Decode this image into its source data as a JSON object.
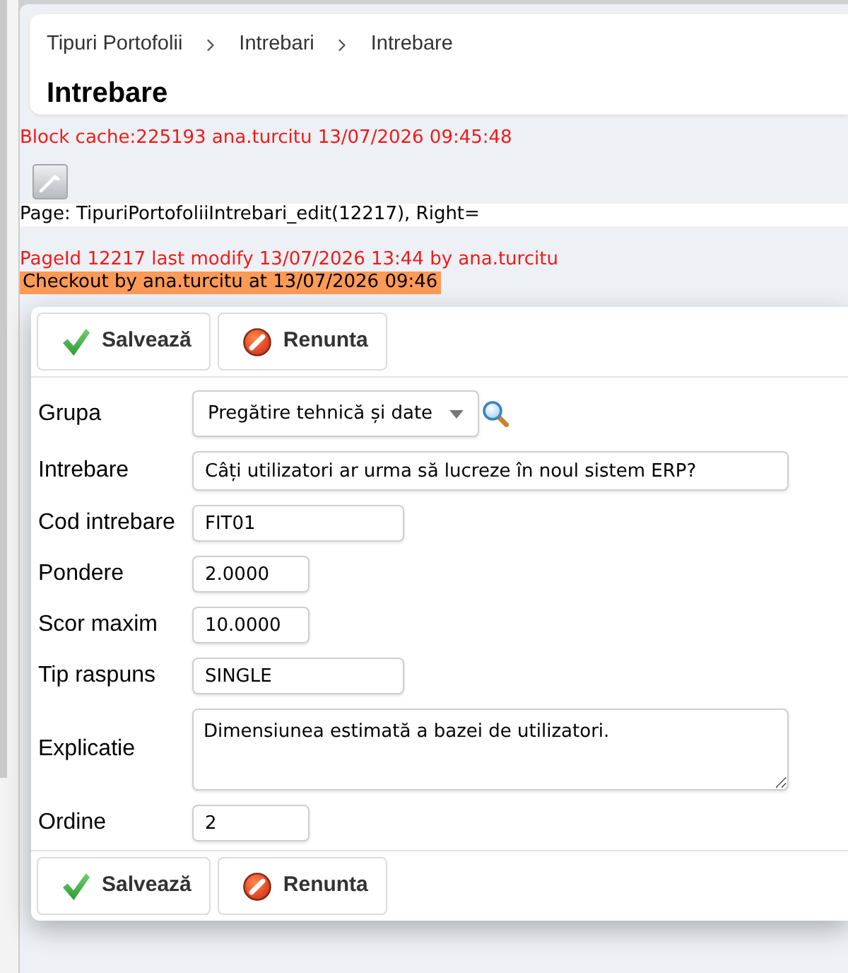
{
  "breadcrumb": [
    "Tipuri Portofolii",
    "Intrebari",
    "Intrebare"
  ],
  "page_title": "Intrebare",
  "debug": {
    "block_cache": "Block cache:225193 ana.turcitu 13/07/2026 09:45:48",
    "page": "Page: TipuriPortofoliiIntrebari_edit(12217), Right=",
    "last_modify": "PageId 12217 last modify 13/07/2026 13:44 by ana.turcitu",
    "checkout": "Checkout by ana.turcitu at 13/07/2026 09:46"
  },
  "toolbar_top": [
    {
      "kind": "save",
      "label": "Salvează"
    },
    {
      "kind": "cancel",
      "label": "Renunta"
    }
  ],
  "fields": [
    {
      "kind": "select",
      "label": "Grupa",
      "value": "Pregătire tehnică și date"
    },
    {
      "kind": "longtext",
      "label": "Intrebare",
      "value": "Câți utilizatori ar urma să lucreze în noul sistem ERP?"
    },
    {
      "kind": "text",
      "label": "Cod intrebare",
      "value": "FIT01"
    },
    {
      "kind": "number",
      "label": "Pondere",
      "value": "2.0000"
    },
    {
      "kind": "number",
      "label": "Scor maxim",
      "value": "10.0000"
    },
    {
      "kind": "text",
      "label": "Tip raspuns",
      "value": "SINGLE"
    },
    {
      "kind": "textarea",
      "label": "Explicatie",
      "value": "Dimensiunea estimată a bazei de utilizatori."
    },
    {
      "kind": "number",
      "label": "Ordine",
      "value": "2"
    }
  ],
  "toolbar_bottom": [
    {
      "kind": "save",
      "label": "Salvează"
    },
    {
      "kind": "cancel",
      "label": "Renunta"
    }
  ]
}
